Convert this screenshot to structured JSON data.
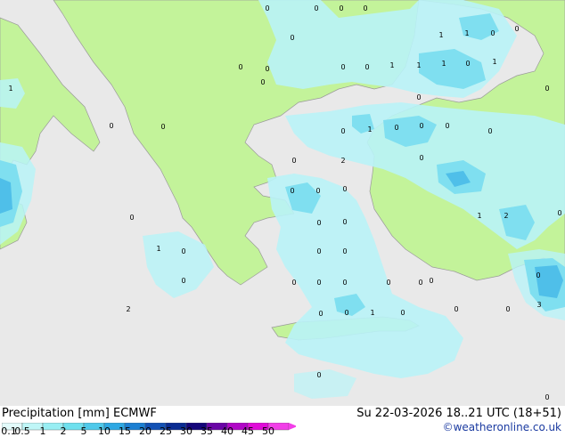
{
  "title": "Precipitation [mm]  ECMWF",
  "valid_time": "Su 22-03-2026 18..21 UTC (18+51)",
  "credit": "©weatheronline.co.uk",
  "colors": {
    "sea": "#e9e9e9",
    "land": "#c3f39a",
    "light_precip": "#b9f3f7",
    "medium_precip": "#7fdff0",
    "heavy_precip": "#4fbfe9"
  },
  "legend": {
    "ticks": [
      "0.1",
      "0.5",
      "1",
      "2",
      "5",
      "10",
      "15",
      "20",
      "25",
      "30",
      "35",
      "40",
      "45",
      "50"
    ],
    "colors": [
      "#e2fbfb",
      "#bff6f7",
      "#98eef3",
      "#6fe0ee",
      "#4fc9ea",
      "#2ea8e3",
      "#1c7fd2",
      "#1351b4",
      "#0a2c92",
      "#14067a",
      "#6a05a6",
      "#b106c7",
      "#e00bd8",
      "#f23ee8"
    ]
  },
  "point_values": [
    "0",
    "0",
    "0",
    "0",
    "0",
    "1",
    "1",
    "0",
    "0",
    "0",
    "0",
    "0",
    "0",
    "1",
    "1",
    "1",
    "0",
    "1",
    "0",
    "1",
    "0",
    "0",
    "0",
    "0",
    "0",
    "1",
    "0",
    "0",
    "0",
    "0",
    "0",
    "2",
    "0",
    "0",
    "0",
    "0",
    "2",
    "1",
    "0",
    "0",
    "0",
    "0",
    "1",
    "0",
    "0",
    "0",
    "0",
    "0",
    "0",
    "0",
    "0",
    "0",
    "0",
    "0",
    "3",
    "2",
    "0",
    "0",
    "1",
    "0",
    "0",
    "0",
    "0",
    "0",
    "0",
    "0",
    "0",
    "0",
    "0"
  ]
}
